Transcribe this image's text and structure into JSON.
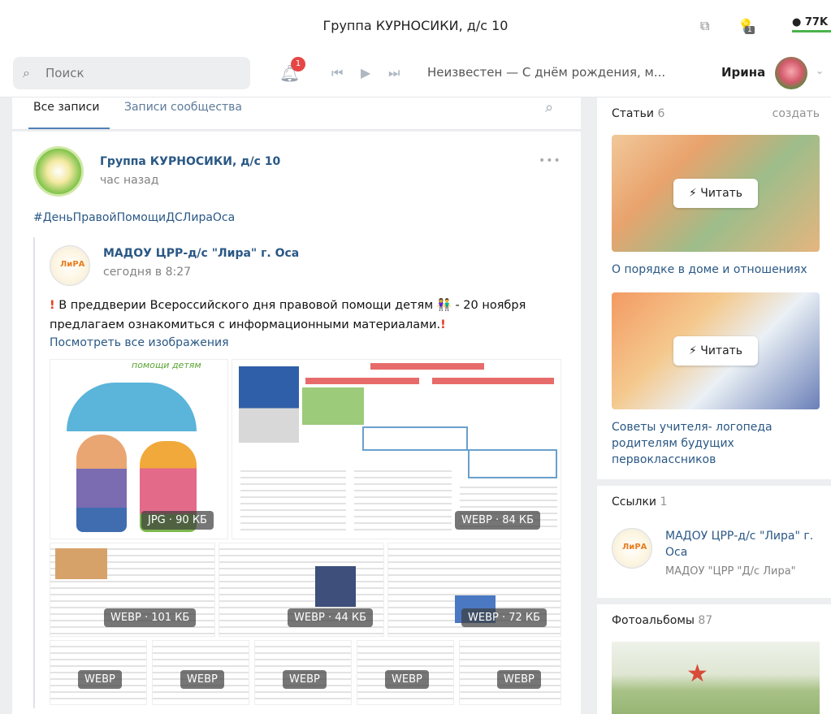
{
  "titlebar": {
    "title": "Группа КУРНОСИКИ, д/с 10",
    "icon_badge": "1",
    "chat_count": "77K"
  },
  "topnav": {
    "search_placeholder": "Поиск",
    "notification_count": "1",
    "track": "Неизвестен — С днём рождения, м...",
    "username": "Ирина"
  },
  "tabs": {
    "all": "Все записи",
    "community": "Записи сообщества"
  },
  "post": {
    "author": "Группа КУРНОСИКИ, д/с 10",
    "time": "час назад",
    "hashtag": "#ДеньПравойПомощиДСЛираОса",
    "repost": {
      "author": "МАДОУ ЦРР-д/с \"Лира\" г. Оса",
      "avatar_text": "ЛиРА",
      "time": "сегодня в 8:27",
      "text_line1": "В преддверии Всероссийского дня правовой помощи детям",
      "text_date": "- 20 ноября",
      "text_line2": "предлагаем ознакомиться с информационными материалами.",
      "link": "Посмотреть все изображения",
      "images": [
        "JPG · 90 КБ",
        "WEBP · 84 КБ",
        "WEBP · 101 КБ",
        "WEBP · 44 КБ",
        "WEBP · 72 КБ",
        "WEBP",
        "WEBP",
        "WEBP",
        "WEBP",
        "WEBP"
      ],
      "image1_caption": "помощи детям"
    }
  },
  "side": {
    "articles": {
      "title": "Статьи",
      "count": "6",
      "create": "создать",
      "read_label": "⚡ Читать",
      "items": [
        "О порядке в доме и отношениях",
        "Советы учителя- логопеда родителям будущих первоклассников"
      ]
    },
    "links": {
      "title": "Ссылки",
      "count": "1",
      "avatar_text": "ЛиРА",
      "item_title": "МАДОУ ЦРР-д/с \"Лира\" г. Оса",
      "item_sub": "МАДОУ \"ЦРР \"Д/с Лира\""
    },
    "albums": {
      "title": "Фотоальбомы",
      "count": "87"
    }
  }
}
